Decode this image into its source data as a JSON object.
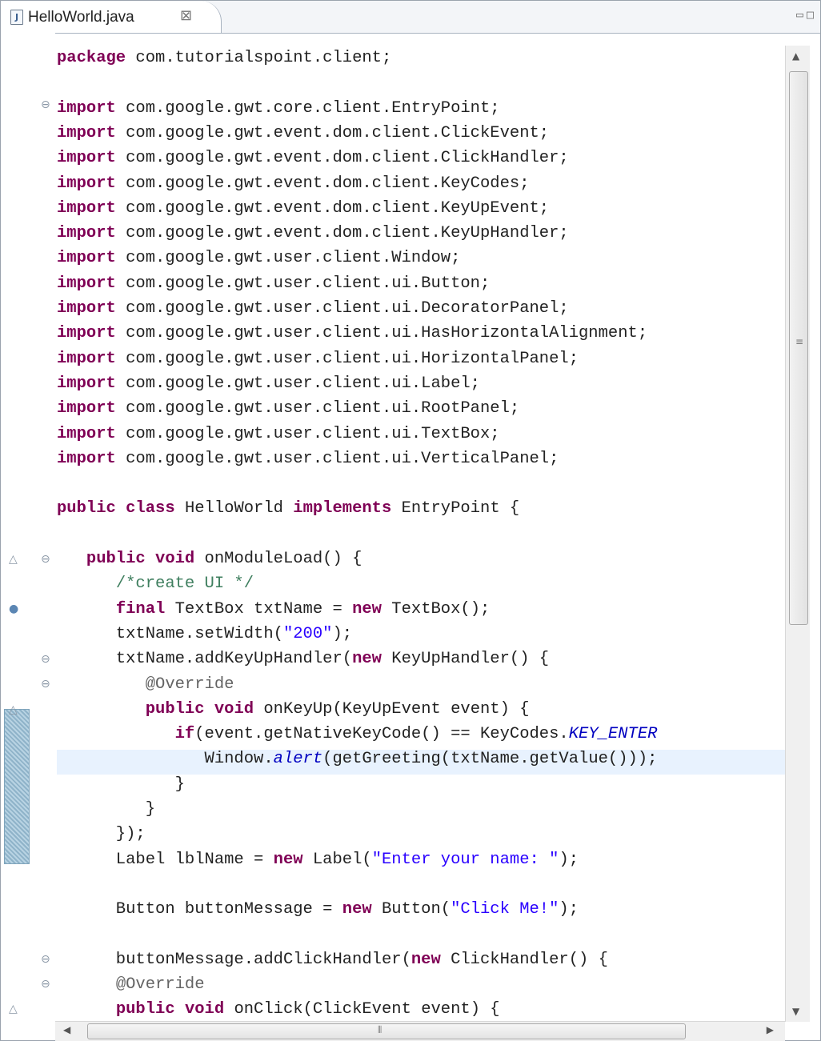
{
  "tab": {
    "icon": "java-file-icon",
    "label": "HelloWorld.java",
    "close": "⊠"
  },
  "window_controls": {
    "minimize": "▭",
    "maximize": "□"
  },
  "code_lines": [
    [
      [
        "kw",
        "package"
      ],
      [
        "t",
        " com.tutorialspoint.client;"
      ]
    ],
    [],
    [
      [
        "kw",
        "import"
      ],
      [
        "t",
        " com.google.gwt.core.client.EntryPoint;"
      ]
    ],
    [
      [
        "kw",
        "import"
      ],
      [
        "t",
        " com.google.gwt.event.dom.client.ClickEvent;"
      ]
    ],
    [
      [
        "kw",
        "import"
      ],
      [
        "t",
        " com.google.gwt.event.dom.client.ClickHandler;"
      ]
    ],
    [
      [
        "kw",
        "import"
      ],
      [
        "t",
        " com.google.gwt.event.dom.client.KeyCodes;"
      ]
    ],
    [
      [
        "kw",
        "import"
      ],
      [
        "t",
        " com.google.gwt.event.dom.client.KeyUpEvent;"
      ]
    ],
    [
      [
        "kw",
        "import"
      ],
      [
        "t",
        " com.google.gwt.event.dom.client.KeyUpHandler;"
      ]
    ],
    [
      [
        "kw",
        "import"
      ],
      [
        "t",
        " com.google.gwt.user.client.Window;"
      ]
    ],
    [
      [
        "kw",
        "import"
      ],
      [
        "t",
        " com.google.gwt.user.client.ui.Button;"
      ]
    ],
    [
      [
        "kw",
        "import"
      ],
      [
        "t",
        " com.google.gwt.user.client.ui.DecoratorPanel;"
      ]
    ],
    [
      [
        "kw",
        "import"
      ],
      [
        "t",
        " com.google.gwt.user.client.ui.HasHorizontalAlignment;"
      ]
    ],
    [
      [
        "kw",
        "import"
      ],
      [
        "t",
        " com.google.gwt.user.client.ui.HorizontalPanel;"
      ]
    ],
    [
      [
        "kw",
        "import"
      ],
      [
        "t",
        " com.google.gwt.user.client.ui.Label;"
      ]
    ],
    [
      [
        "kw",
        "import"
      ],
      [
        "t",
        " com.google.gwt.user.client.ui.RootPanel;"
      ]
    ],
    [
      [
        "kw",
        "import"
      ],
      [
        "t",
        " com.google.gwt.user.client.ui.TextBox;"
      ]
    ],
    [
      [
        "kw",
        "import"
      ],
      [
        "t",
        " com.google.gwt.user.client.ui.VerticalPanel;"
      ]
    ],
    [],
    [
      [
        "kw",
        "public"
      ],
      [
        "t",
        " "
      ],
      [
        "kw",
        "class"
      ],
      [
        "t",
        " HelloWorld "
      ],
      [
        "kw",
        "implements"
      ],
      [
        "t",
        " EntryPoint {"
      ]
    ],
    [],
    [
      [
        "t",
        "   "
      ],
      [
        "kw",
        "public"
      ],
      [
        "t",
        " "
      ],
      [
        "kw",
        "void"
      ],
      [
        "t",
        " onModuleLoad() {"
      ]
    ],
    [
      [
        "t",
        "      "
      ],
      [
        "cm",
        "/*create UI */"
      ]
    ],
    [
      [
        "t",
        "      "
      ],
      [
        "kw",
        "final"
      ],
      [
        "t",
        " TextBox txtName = "
      ],
      [
        "kw",
        "new"
      ],
      [
        "t",
        " TextBox();"
      ]
    ],
    [
      [
        "t",
        "      txtName.setWidth("
      ],
      [
        "str",
        "\"200\""
      ],
      [
        "t",
        ");"
      ]
    ],
    [
      [
        "t",
        "      txtName.addKeyUpHandler("
      ],
      [
        "kw",
        "new"
      ],
      [
        "t",
        " KeyUpHandler() {"
      ]
    ],
    [
      [
        "t",
        "         "
      ],
      [
        "an",
        "@Override"
      ]
    ],
    [
      [
        "t",
        "         "
      ],
      [
        "kw",
        "public"
      ],
      [
        "t",
        " "
      ],
      [
        "kw",
        "void"
      ],
      [
        "t",
        " onKeyUp(KeyUpEvent event) {"
      ]
    ],
    [
      [
        "t",
        "            "
      ],
      [
        "kw",
        "if"
      ],
      [
        "t",
        "(event.getNativeKeyCode() == KeyCodes."
      ],
      [
        "it",
        "KEY_ENTER"
      ]
    ],
    [
      [
        "t",
        "               Window."
      ],
      [
        "it",
        "alert"
      ],
      [
        "t",
        "(getGreeting(txtName.getValue()));"
      ]
    ],
    [
      [
        "t",
        "            }"
      ]
    ],
    [
      [
        "t",
        "         }"
      ]
    ],
    [
      [
        "t",
        "      });"
      ]
    ],
    [
      [
        "t",
        "      Label lblName = "
      ],
      [
        "kw",
        "new"
      ],
      [
        "t",
        " Label("
      ],
      [
        "str",
        "\"Enter your name: \""
      ],
      [
        "t",
        ");"
      ]
    ],
    [],
    [
      [
        "t",
        "      Button buttonMessage = "
      ],
      [
        "kw",
        "new"
      ],
      [
        "t",
        " Button("
      ],
      [
        "str",
        "\"Click Me!\""
      ],
      [
        "t",
        ");"
      ]
    ],
    [],
    [
      [
        "t",
        "      buttonMessage.addClickHandler("
      ],
      [
        "kw",
        "new"
      ],
      [
        "t",
        " ClickHandler() {"
      ]
    ],
    [
      [
        "t",
        "      "
      ],
      [
        "an",
        "@Override"
      ]
    ],
    [
      [
        "t",
        "      "
      ],
      [
        "kw",
        "public"
      ],
      [
        "t",
        " "
      ],
      [
        "kw",
        "void"
      ],
      [
        "t",
        " onClick(ClickEvent event) {"
      ]
    ]
  ],
  "scrollbar": {
    "grip_v": "≡",
    "grip_h": "⦀"
  }
}
